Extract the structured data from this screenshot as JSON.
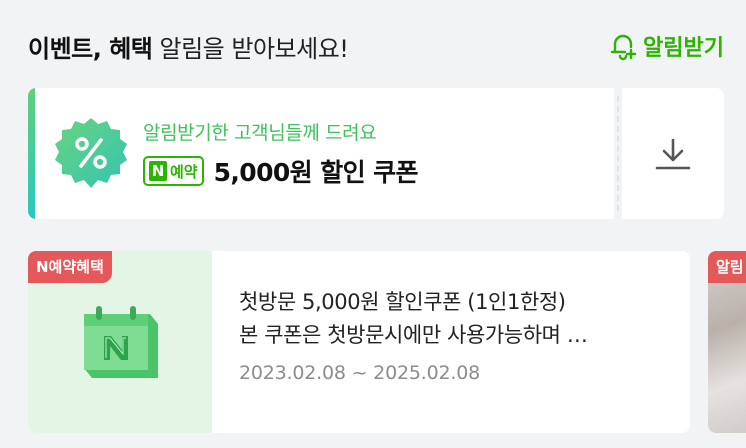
{
  "header": {
    "title_bold": "이벤트, 혜택",
    "title_rest": " 알림을 받아보세요!",
    "notify_label": "알림받기",
    "notify_icon": "bell-plus-icon",
    "accent": "#2db400"
  },
  "coupon": {
    "subtitle": "알림받기한 고객님들께 드려요",
    "tag_n": "N",
    "tag_label": "예약",
    "amount": "5,000원 할인 쿠폰",
    "badge_icon": "percent-icon",
    "download_icon": "download-icon"
  },
  "benefit_card": {
    "label": "N예약혜택",
    "title": "첫방문 5,000원 할인쿠폰 (1인1한정)",
    "description": "본 쿠폰은 첫방문시에만 사용가능하며 …",
    "date_range": "2023.02.08 ~ 2025.02.08",
    "thumb_icon": "calendar-n-icon",
    "label_color": "#e5585a"
  },
  "next_card": {
    "label": "알림"
  }
}
